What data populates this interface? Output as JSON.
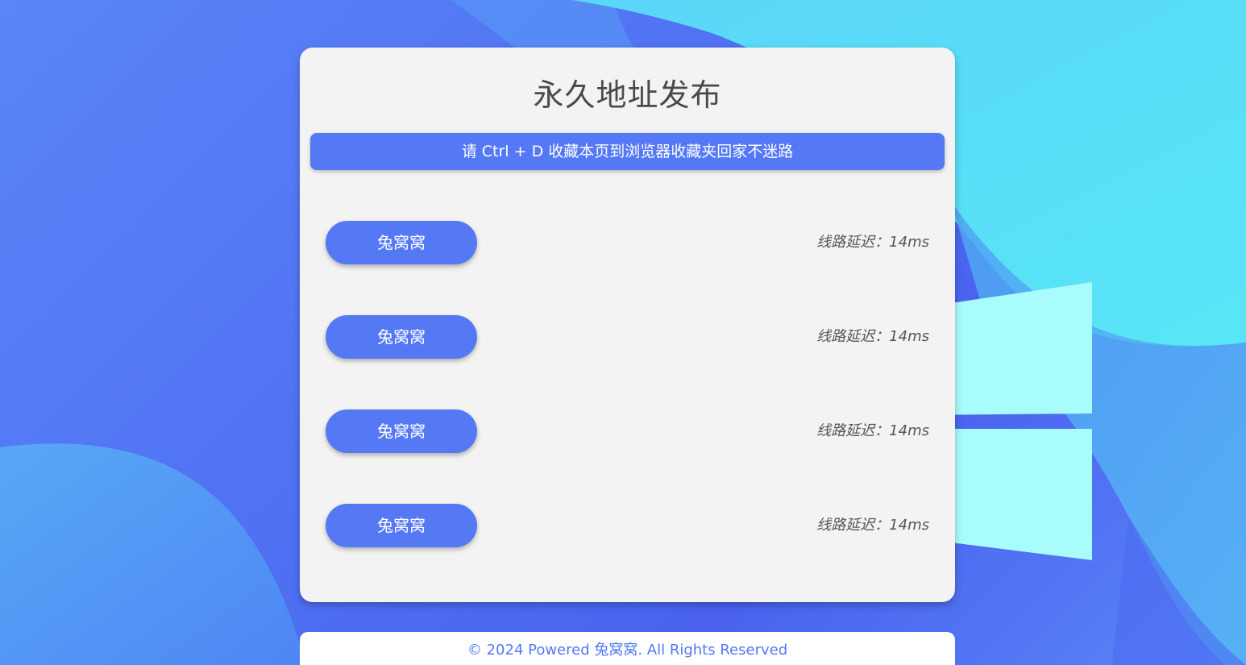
{
  "page": {
    "title": "永久地址发布",
    "notice": "请 Ctrl + D 收藏本页到浏览器收藏夹回家不迷路"
  },
  "lines": [
    {
      "label": "兔窝窝",
      "latency": "线路延迟：14ms"
    },
    {
      "label": "兔窝窝",
      "latency": "线路延迟：14ms"
    },
    {
      "label": "兔窝窝",
      "latency": "线路延迟：14ms"
    },
    {
      "label": "兔窝窝",
      "latency": "线路延迟：14ms"
    }
  ],
  "footer": {
    "text": "© 2024 Powered 兔窝窝. All Rights Reserved"
  },
  "colors": {
    "accent": "#5578f5",
    "background": "#4f6ff2",
    "card": "#f3f3f3",
    "windows_logo": "#a8fcfb"
  }
}
